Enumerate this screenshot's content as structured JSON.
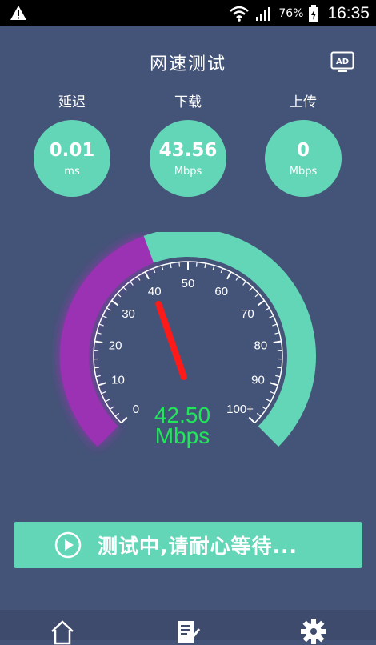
{
  "status_bar": {
    "battery_percent": "76%",
    "time": "16:35",
    "icons": [
      "warning-icon",
      "wifi-icon",
      "signal-icon",
      "battery-icon"
    ]
  },
  "header": {
    "title": "网速测试",
    "ad_label": "AD"
  },
  "metrics": [
    {
      "label": "延迟",
      "value": "0.01",
      "unit": "ms"
    },
    {
      "label": "下载",
      "value": "43.56",
      "unit": "Mbps"
    },
    {
      "label": "上传",
      "value": "0",
      "unit": "Mbps"
    }
  ],
  "gauge": {
    "current_value": "42.50",
    "unit": "Mbps",
    "value_numeric": 42.5,
    "tick_labels": [
      "0",
      "10",
      "20",
      "30",
      "40",
      "50",
      "60",
      "70",
      "80",
      "90",
      "100+"
    ],
    "colors": {
      "filled": "#9b30b4",
      "remaining": "#64d6b8",
      "needle": "#ff1a1a",
      "readout": "#22e65a"
    }
  },
  "action_button": {
    "label": "测试中,请耐心等待..."
  },
  "bottom_nav": {
    "items": [
      "home-icon",
      "edit-note-icon",
      "settings-icon"
    ]
  }
}
